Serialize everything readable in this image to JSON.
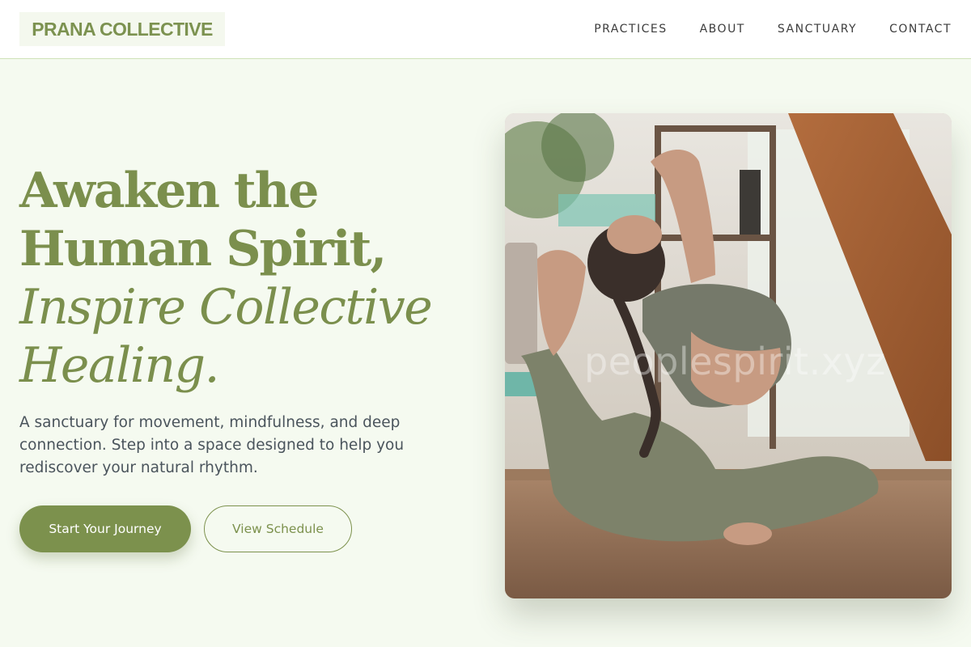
{
  "brand": {
    "name": "PRANA COLLECTIVE"
  },
  "nav": {
    "items": [
      "PRACTICES",
      "ABOUT",
      "SANCTUARY",
      "CONTACT"
    ]
  },
  "hero": {
    "title_line1": "Awaken the",
    "title_line2": "Human Spirit,",
    "title_line3": "Inspire Collective",
    "title_line4": "Healing.",
    "description": "A sanctuary for movement, mindfulness, and deep connection. Step into a space designed to help you rediscover your natural rhythm.",
    "primary_cta": "Start Your Journey",
    "secondary_cta": "View Schedule"
  },
  "image": {
    "watermark": "peoplespirit.xyz"
  },
  "colors": {
    "accent": "#7c914d",
    "background": "#f5faf0",
    "header_bg": "#ffffff",
    "body_text": "#4a545c"
  }
}
